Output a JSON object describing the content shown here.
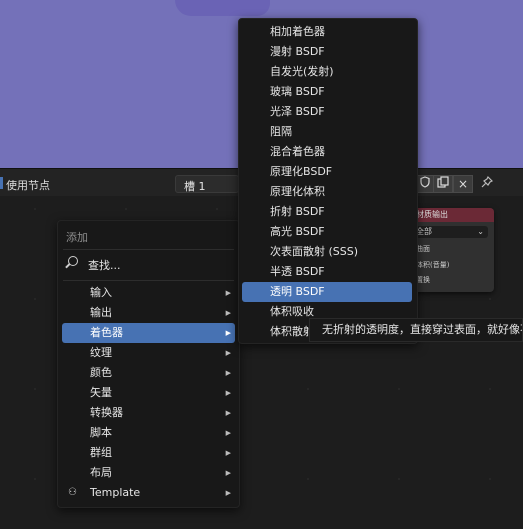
{
  "header": {
    "use_nodes_label": "使用节点",
    "slot_label": "槽 1",
    "shield_icon": "shield-icon",
    "copy_icon": "copy-icon",
    "close_icon": "×",
    "pin_icon": "pin-icon"
  },
  "node": {
    "title": "材质输出",
    "target": "全部",
    "sockets": [
      "曲面",
      "体积(音量)",
      "置换"
    ]
  },
  "add_menu": {
    "title": "添加",
    "search_label": "查找...",
    "items": [
      {
        "label": "输入",
        "arrow": "▶"
      },
      {
        "label": "输出",
        "arrow": "▶"
      },
      {
        "label": "着色器",
        "arrow": "▶"
      },
      {
        "label": "纹理",
        "arrow": "▶"
      },
      {
        "label": "颜色",
        "arrow": "▶"
      },
      {
        "label": "矢量",
        "arrow": "▶"
      },
      {
        "label": "转换器",
        "arrow": "▶"
      },
      {
        "label": "脚本",
        "arrow": "▶"
      },
      {
        "label": "群组",
        "arrow": "▶"
      },
      {
        "label": "布局",
        "arrow": "▶"
      },
      {
        "label": "Template",
        "arrow": "▶"
      }
    ]
  },
  "shader_menu": {
    "items": [
      {
        "label": "相加着色器"
      },
      {
        "label": "漫射 BSDF"
      },
      {
        "label": "自发光(发射)"
      },
      {
        "label": "玻璃 BSDF"
      },
      {
        "label": "光泽 BSDF"
      },
      {
        "label": "阻隔"
      },
      {
        "label": "混合着色器"
      },
      {
        "label": "原理化BSDF"
      },
      {
        "label": "原理化体积"
      },
      {
        "label": "折射 BSDF"
      },
      {
        "label": "高光 BSDF"
      },
      {
        "label": "次表面散射 (SSS)"
      },
      {
        "label": "半透 BSDF"
      },
      {
        "label": "透明 BSDF"
      },
      {
        "label": "体积吸收"
      },
      {
        "label": "体积散射"
      }
    ]
  },
  "tooltip": {
    "text": "无折射的透明度，直接穿过表面，就好像不"
  },
  "colors": {
    "viewport_bg": "#7471b9",
    "highlight": "#4772b3",
    "menu_bg": "#181818",
    "node_header": "#6b2936"
  }
}
